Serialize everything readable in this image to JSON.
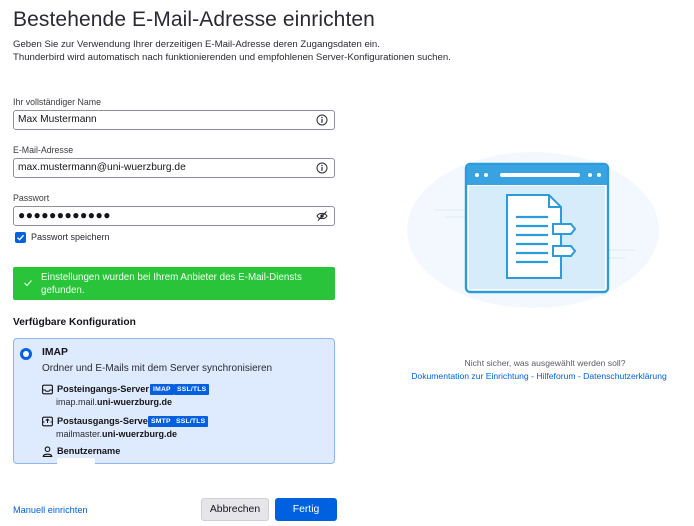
{
  "header": {
    "title": "Bestehende E-Mail-Adresse einrichten",
    "subtitle_line1": "Geben Sie zur Verwendung Ihrer derzeitigen E-Mail-Adresse deren Zugangsdaten ein.",
    "subtitle_line2": "Thunderbird wird automatisch nach funktionierenden und empfohlenen Server-Konfigurationen suchen."
  },
  "form": {
    "name_label": "Ihr vollständiger Name",
    "name_value": "Max Mustermann",
    "email_label": "E-Mail-Adresse",
    "email_value": "max.mustermann@uni-wuerzburg.de",
    "password_label": "Passwort",
    "password_value": "●●●●●●●●●●●●",
    "remember_password_label": "Passwort speichern",
    "remember_password_checked": true
  },
  "status": {
    "success_message": "Einstellungen wurden bei Ihrem Anbieter des E-Mail-Diensts gefunden."
  },
  "config": {
    "section_title": "Verfügbare Konfiguration",
    "protocol": "IMAP",
    "protocol_desc": "Ordner und E-Mails mit dem Server synchronisieren",
    "incoming_label": "Posteingangs-Server",
    "incoming_badge1": "IMAP",
    "incoming_badge2": "SSL/TLS",
    "incoming_host_prefix": "imap.mail.",
    "incoming_host_domain": "uni-wuerzburg.de",
    "outgoing_label": "Postausgangs-Server",
    "outgoing_badge1": "SMTP",
    "outgoing_badge2": "SSL/TLS",
    "outgoing_host_prefix": "mailmaster.",
    "outgoing_host_domain": "uni-wuerzburg.de",
    "username_label": "Benutzername",
    "badge_color": "#0060df"
  },
  "footer": {
    "manual_link": "Manuell einrichten",
    "cancel_label": "Abbrechen",
    "done_label": "Fertig"
  },
  "help": {
    "question": "Nicht sicher, was ausgewählt werden soll?",
    "link_docs": "Dokumentation zur Einrichtung",
    "link_forum": "Hilfeforum",
    "link_privacy": "Datenschutzerklärung",
    "separator": " - "
  },
  "icons": {
    "name_info": "info-circle-icon",
    "email_info": "info-circle-icon",
    "password_toggle": "eye-slash-icon",
    "incoming": "inbox-icon",
    "outgoing": "outbox-icon",
    "username": "person-icon",
    "illustration": "browser-document-illustration"
  },
  "colors": {
    "accent": "#0061e0",
    "success": "#2ac43a",
    "config_bg": "#deeafd"
  }
}
